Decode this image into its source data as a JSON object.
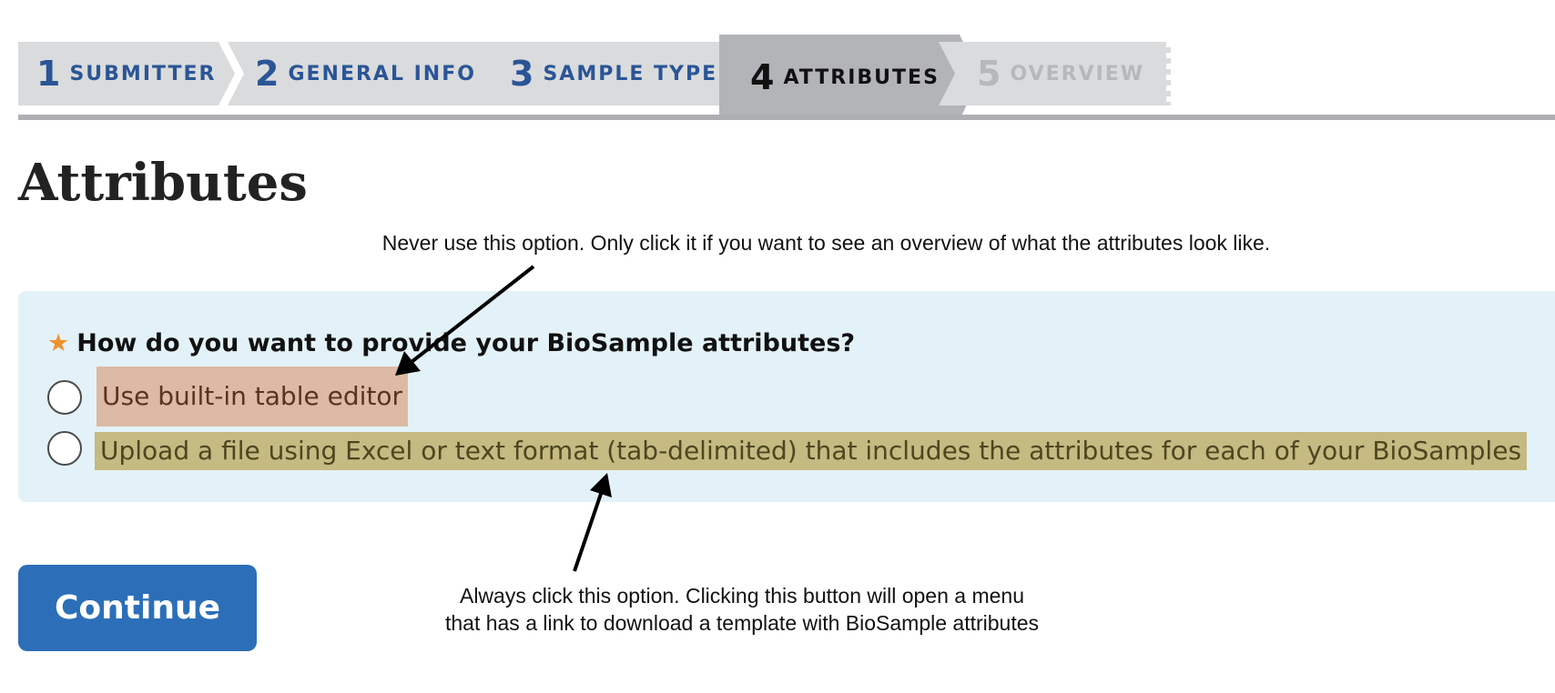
{
  "steps": [
    {
      "num": "1",
      "label": "SUBMITTER",
      "state": "done"
    },
    {
      "num": "2",
      "label": "GENERAL INFO",
      "state": "done"
    },
    {
      "num": "3",
      "label": "SAMPLE TYPE",
      "state": "done"
    },
    {
      "num": "4",
      "label": "ATTRIBUTES",
      "state": "active"
    },
    {
      "num": "5",
      "label": "OVERVIEW",
      "state": "disabled"
    }
  ],
  "page_title": "Attributes",
  "notes": {
    "top": "Never use this option. Only click it if you want to see an overview of what the attributes look like.",
    "bottom_line1": "Always click this option.  Clicking this button will open a menu",
    "bottom_line2": "that has a link to download a template with BioSample attributes"
  },
  "question": {
    "required_mark": "★",
    "text": "How do you want to provide your BioSample attributes?"
  },
  "options": [
    {
      "label": "Use built-in table editor",
      "highlight": "#dcbaa4"
    },
    {
      "label": "Upload a file using Excel or text format (tab-delimited) that includes the attributes for each of your BioSamples",
      "highlight": "#c4ba82"
    }
  ],
  "continue_label": "Continue",
  "colors": {
    "accent": "#2c6fb8",
    "step_text": "#2a5596",
    "panel_bg": "#e3f2f8",
    "required": "#f0922d"
  }
}
